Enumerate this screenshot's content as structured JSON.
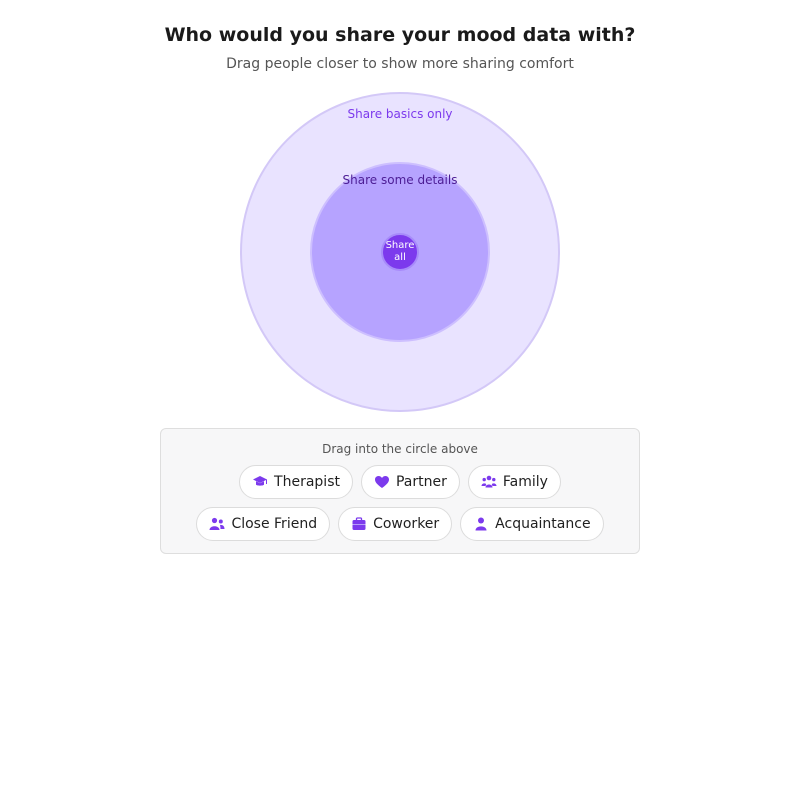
{
  "header": {
    "title": "Who would you share your mood data with?",
    "subtitle": "Drag people closer to show more sharing comfort"
  },
  "rings": {
    "outer_label": "Share basics only",
    "middle_label": "Share some details",
    "inner_label_line1": "Share",
    "inner_label_line2": "all"
  },
  "tray": {
    "hint": "Drag into the circle above",
    "people": [
      {
        "label": "Therapist",
        "icon": "graduation-cap-icon"
      },
      {
        "label": "Partner",
        "icon": "heart-icon"
      },
      {
        "label": "Family",
        "icon": "family-icon"
      },
      {
        "label": "Close Friend",
        "icon": "friends-icon"
      },
      {
        "label": "Coworker",
        "icon": "briefcase-icon"
      },
      {
        "label": "Acquaintance",
        "icon": "person-icon"
      }
    ]
  },
  "colors": {
    "accent": "#7c3aed",
    "outer_ring": "#e9e3ff",
    "middle_ring": "#b6a3ff",
    "inner_ring": "#7c3aed"
  }
}
